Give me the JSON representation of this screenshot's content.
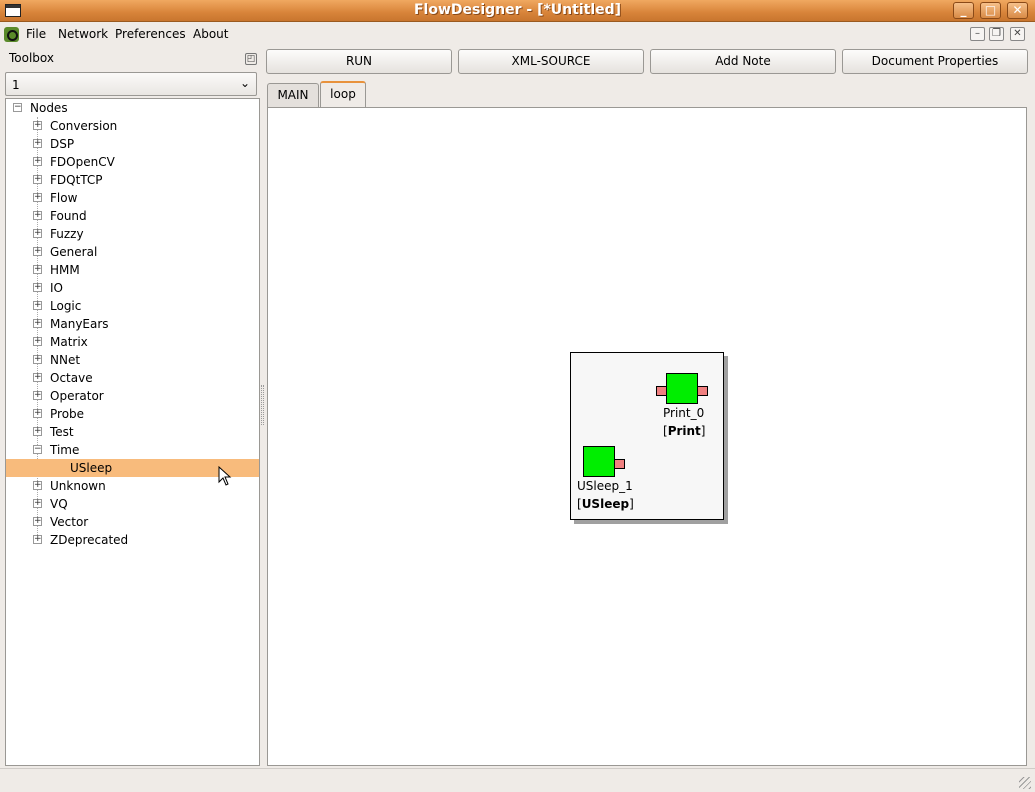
{
  "window": {
    "title": "FlowDesigner - [*Untitled]"
  },
  "menu": {
    "items": [
      "File",
      "Network",
      "Preferences",
      "About"
    ]
  },
  "toolbox": {
    "title": "Toolbox",
    "combo_value": "1",
    "tree": {
      "root": "Nodes",
      "categories": [
        "Conversion",
        "DSP",
        "FDOpenCV",
        "FDQtTCP",
        "Flow",
        "Found",
        "Fuzzy",
        "General",
        "HMM",
        "IO",
        "Logic",
        "ManyEars",
        "Matrix",
        "NNet",
        "Octave",
        "Operator",
        "Probe",
        "Test",
        "Time"
      ],
      "expanded_child": "USleep",
      "after": [
        "Unknown",
        "VQ",
        "Vector",
        "ZDeprecated"
      ]
    }
  },
  "toolbar": {
    "run": "RUN",
    "xml": "XML-SOURCE",
    "note": "Add Note",
    "doc": "Document Properties"
  },
  "tabs": [
    "MAIN",
    "loop"
  ],
  "nodes": {
    "print": {
      "name": "Print_0",
      "type": "Print"
    },
    "usleep": {
      "name": "USleep_1",
      "type": "USleep"
    }
  }
}
